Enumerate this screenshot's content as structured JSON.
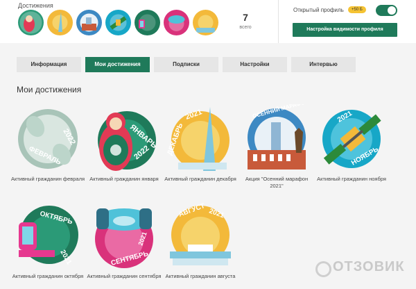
{
  "header": {
    "achievements_title": "Достижения",
    "count": "7",
    "count_label": "всего",
    "open_profile_label": "Открытый профиль",
    "points_badge": "+50 Б",
    "toggle_on": true,
    "visibility_button": "Настройка видимости профиля"
  },
  "mini_badges": [
    {
      "name": "january",
      "color": "#2b9a77"
    },
    {
      "name": "december",
      "color": "#f3b93a"
    },
    {
      "name": "marathon",
      "color": "#3d89c3"
    },
    {
      "name": "november",
      "color": "#17a7c7"
    },
    {
      "name": "october",
      "color": "#1f7a5a"
    },
    {
      "name": "september",
      "color": "#d9327b"
    },
    {
      "name": "august",
      "color": "#f3b93a"
    }
  ],
  "tabs": [
    {
      "label": "Информация",
      "active": false
    },
    {
      "label": "Мои достижения",
      "active": true
    },
    {
      "label": "Подписки",
      "active": false
    },
    {
      "label": "Настройки",
      "active": false
    },
    {
      "label": "Интервью",
      "active": false
    }
  ],
  "section_title": "Мои достижения",
  "badges": [
    {
      "label": "Активный гражданин февраля",
      "text": "ФЕВРАЛЬ",
      "year": "2022",
      "color": "#a8c4b8"
    },
    {
      "label": "Активный гражданин января",
      "text": "ЯНВАРЬ",
      "year": "2022",
      "color": "#1f7a5a"
    },
    {
      "label": "Активный гражданин декабря",
      "text": "ДЕКАБРЬ",
      "year": "2021",
      "color": "#f3b93a"
    },
    {
      "label": "Акция \"Осенний марафон 2021\"",
      "text": "ОСЕННИЙ МАРАФОН",
      "year": "",
      "color": "#3d89c3"
    },
    {
      "label": "Активный гражданин ноября",
      "text": "НОЯБРЬ",
      "year": "2021",
      "color": "#17a7c7"
    },
    {
      "label": "Активный гражданин октября",
      "text": "ОКТЯБРЬ",
      "year": "2021",
      "color": "#1f7a5a"
    },
    {
      "label": "Активный гражданин сентября",
      "text": "СЕНТЯБРЬ",
      "year": "2021",
      "color": "#d9327b"
    },
    {
      "label": "Активный гражданин августа",
      "text": "АВГУСТ",
      "year": "2021",
      "color": "#f3b93a"
    }
  ],
  "watermark": "ОТЗОВИК"
}
